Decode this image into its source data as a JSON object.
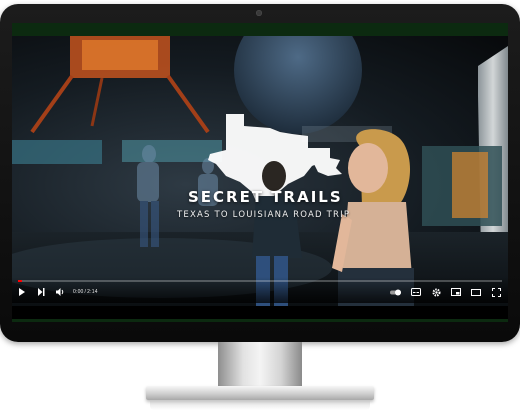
{
  "video": {
    "title": "SECRET TRAILS",
    "subtitle": "TEXAS TO LOUISIANA ROAD TRIP",
    "time_current": "0:00",
    "time_total": "2:14",
    "progress_fraction": 0.0
  },
  "controls": {
    "left": [
      {
        "name": "play-icon"
      },
      {
        "name": "next-icon"
      },
      {
        "name": "volume-icon"
      }
    ],
    "right": [
      {
        "name": "autoplay-toggle-icon"
      },
      {
        "name": "subtitles-icon"
      },
      {
        "name": "settings-gear-icon"
      },
      {
        "name": "miniplayer-icon"
      },
      {
        "name": "theater-mode-icon"
      },
      {
        "name": "fullscreen-icon"
      }
    ]
  },
  "colors": {
    "progress": "#ff0000",
    "screen_edge": "#0c2a10",
    "bezel": "#111111"
  }
}
